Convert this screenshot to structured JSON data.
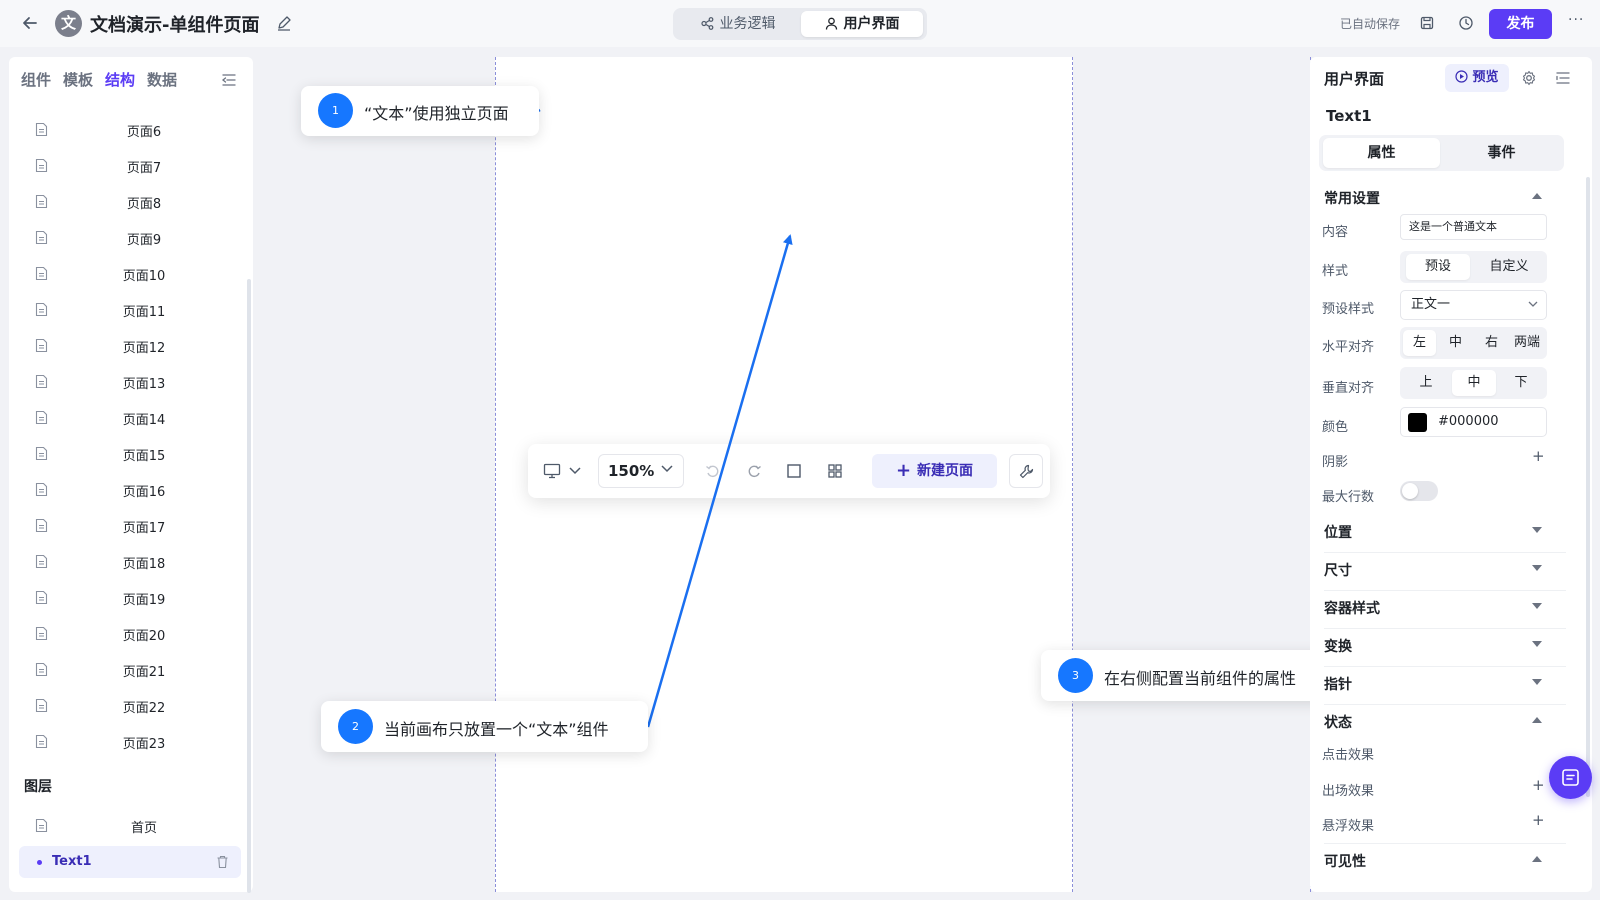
{
  "header": {
    "doc_avatar": "文",
    "title": "文档演示-单组件页面",
    "modes": [
      "业务逻辑",
      "用户界面"
    ],
    "active_mode": "用户界面",
    "autosave": "已自动保存",
    "publish": "发布",
    "more": "···"
  },
  "left_panel": {
    "tabs": [
      "组件",
      "模板",
      "结构",
      "数据"
    ],
    "active_tab": "结构",
    "pages": [
      "页面6",
      "页面7",
      "页面8",
      "页面9",
      "页面10",
      "页面11",
      "页面12",
      "页面13",
      "页面14",
      "页面15",
      "页面16",
      "页面17",
      "页面18",
      "页面19",
      "页面20",
      "页面21",
      "页面22",
      "页面23"
    ],
    "layers_title": "图层",
    "layers": {
      "home": "首页",
      "selected": "Text1"
    }
  },
  "canvas_toolbar": {
    "zoom": "150%",
    "new_page": "新建页面"
  },
  "callouts": [
    {
      "num": "1",
      "text": "“文本”使用独立页面"
    },
    {
      "num": "2",
      "text": "当前画布只放置一个“文本”组件"
    },
    {
      "num": "3",
      "text": "在右侧配置当前组件的属性"
    }
  ],
  "right_panel": {
    "title": "用户界面",
    "preview": "预览",
    "component_name": "Text1",
    "tabs": [
      "属性",
      "事件"
    ],
    "active_tab": "属性",
    "common_settings": "常用设置",
    "content_label": "内容",
    "content_value": "这是一个普通文本",
    "style_label": "样式",
    "style_options": [
      "预设",
      "自定义"
    ],
    "style_selected": "预设",
    "preset_label": "预设样式",
    "preset_value": "正文一",
    "halign_label": "水平对齐",
    "halign_options": [
      "左",
      "中",
      "右",
      "两端"
    ],
    "halign_selected": "左",
    "valign_label": "垂直对齐",
    "valign_options": [
      "上",
      "中",
      "下"
    ],
    "valign_selected": "中",
    "color_label": "颜色",
    "color_value": "#000000",
    "shadow_label": "阴影",
    "maxlines_label": "最大行数",
    "maxlines_enabled": false,
    "sections": [
      "位置",
      "尺寸",
      "容器样式",
      "变换",
      "指针",
      "状态"
    ],
    "state_items": [
      "点击效果",
      "出场效果",
      "悬浮效果"
    ],
    "visibility": "可见性"
  },
  "colors": {
    "accent": "#5b3cf5",
    "callout_num": "#1677ff",
    "arrow": "#1a6ff0"
  }
}
